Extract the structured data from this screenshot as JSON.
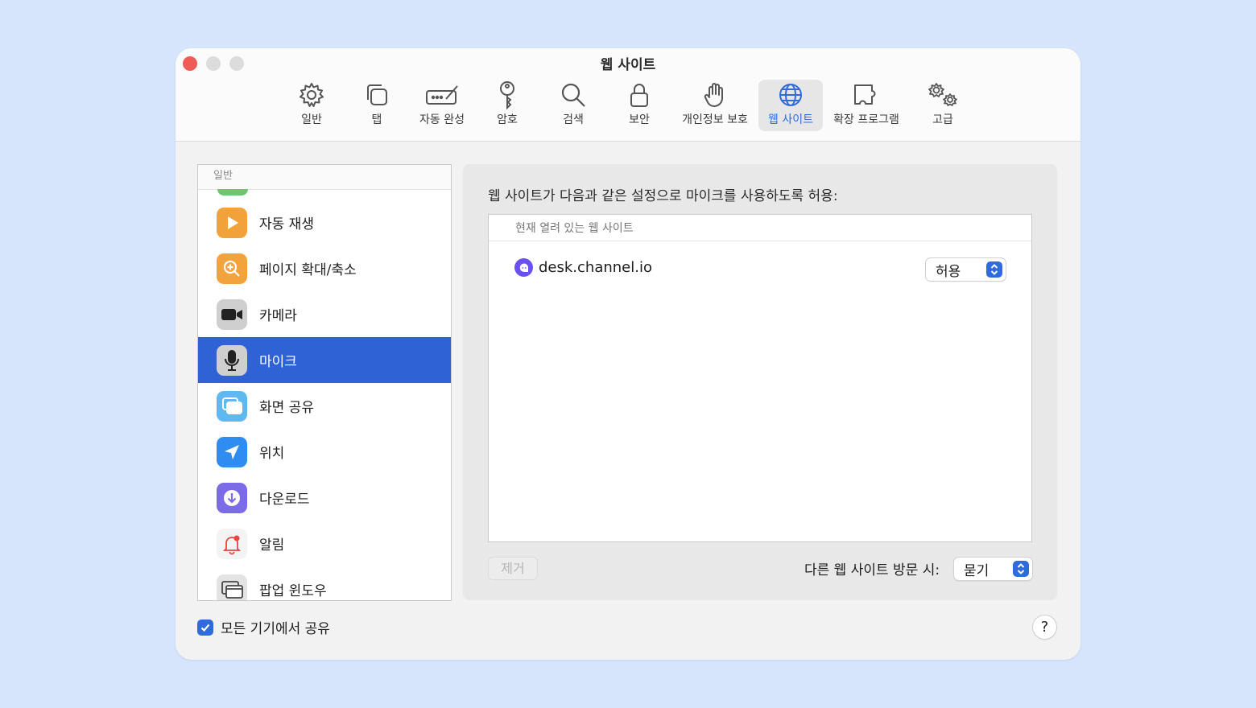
{
  "window": {
    "title": "웹 사이트"
  },
  "toolbar": {
    "items": [
      {
        "label": "일반",
        "icon": "gear-icon"
      },
      {
        "label": "탭",
        "icon": "tabs-icon"
      },
      {
        "label": "자동 완성",
        "icon": "autofill-icon"
      },
      {
        "label": "암호",
        "icon": "key-icon"
      },
      {
        "label": "검색",
        "icon": "search-icon"
      },
      {
        "label": "보안",
        "icon": "lock-icon"
      },
      {
        "label": "개인정보 보호",
        "icon": "hand-icon"
      },
      {
        "label": "웹 사이트",
        "icon": "globe-icon",
        "active": true
      },
      {
        "label": "확장 프로그램",
        "icon": "puzzle-icon"
      },
      {
        "label": "고급",
        "icon": "gears-icon"
      }
    ]
  },
  "sidebar": {
    "header": "일반",
    "items": [
      {
        "label": "자동 재생",
        "icon": "play-icon"
      },
      {
        "label": "페이지 확대/축소",
        "icon": "zoom-icon"
      },
      {
        "label": "카메라",
        "icon": "camera-icon"
      },
      {
        "label": "마이크",
        "icon": "microphone-icon",
        "selected": true
      },
      {
        "label": "화면 공유",
        "icon": "screen-share-icon"
      },
      {
        "label": "위치",
        "icon": "location-icon"
      },
      {
        "label": "다운로드",
        "icon": "download-icon"
      },
      {
        "label": "알림",
        "icon": "bell-icon"
      },
      {
        "label": "팝업 윈도우",
        "icon": "popup-window-icon"
      }
    ]
  },
  "main": {
    "description": "웹 사이트가 다음과 같은 설정으로 마이크를 사용하도록 허용:",
    "table_header": "현재 열려 있는 웹 사이트",
    "sites": [
      {
        "name": "desk.channel.io",
        "setting": "허용"
      }
    ],
    "remove_label": "제거",
    "other_sites_label": "다른 웹 사이트 방문 시:",
    "other_sites_value": "묻기"
  },
  "footer": {
    "share_label": "모든 기기에서 공유",
    "share_checked": true,
    "help_label": "?"
  },
  "colors": {
    "accent": "#2f6bdb",
    "selection": "#2f62d5",
    "background": "#d7e5fc"
  }
}
